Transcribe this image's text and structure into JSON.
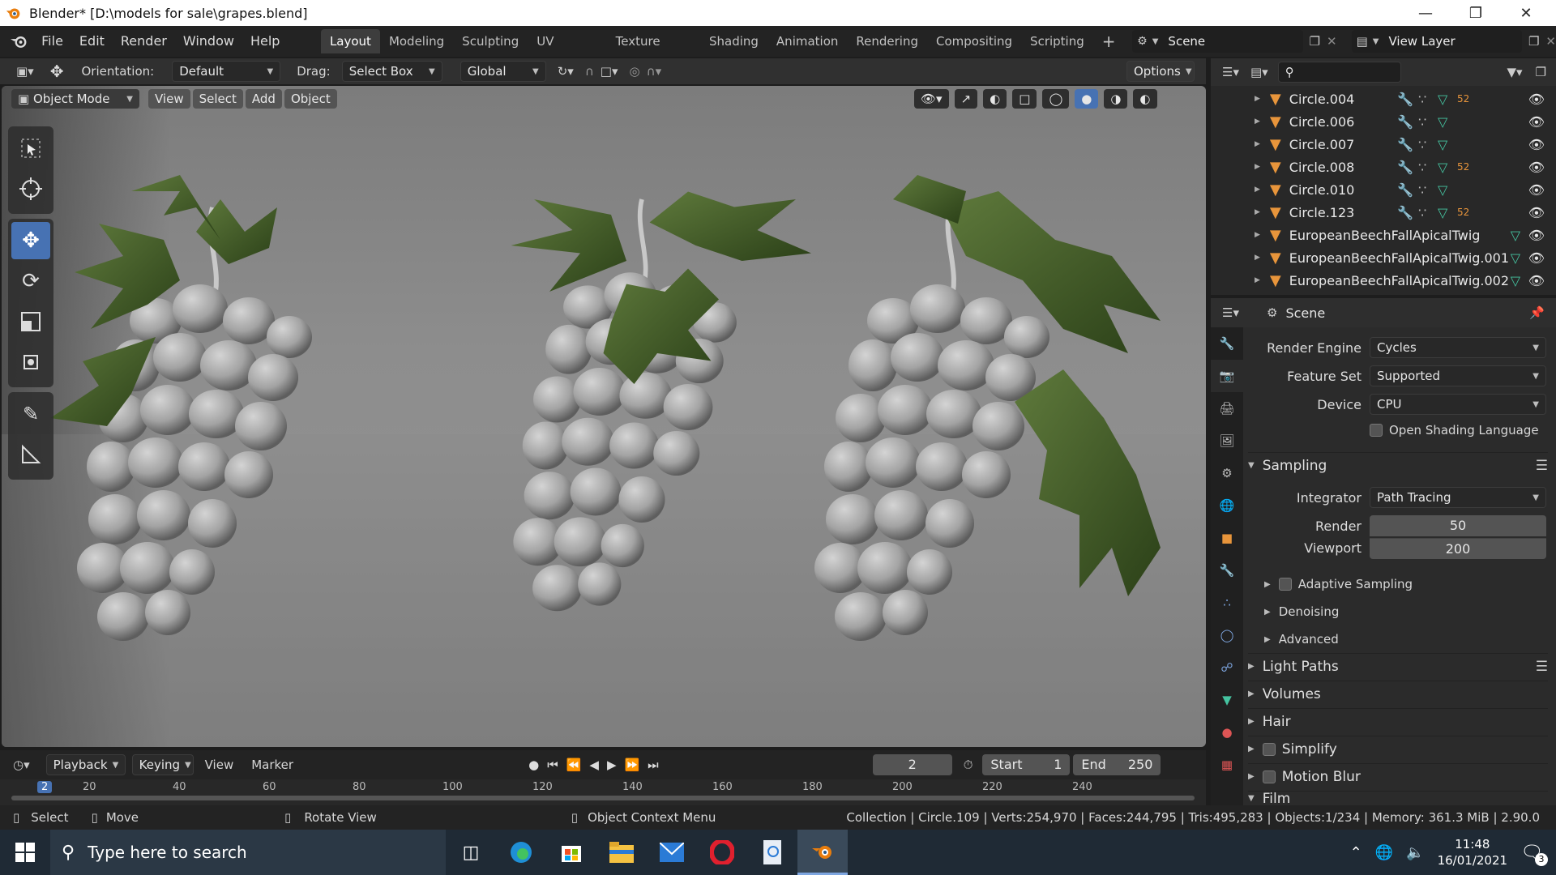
{
  "window": {
    "title": "Blender* [D:\\models for sale\\grapes.blend]"
  },
  "menus": [
    "File",
    "Edit",
    "Render",
    "Window",
    "Help"
  ],
  "workspaces": [
    "Layout",
    "Modeling",
    "Sculpting",
    "UV Editing",
    "Texture Paint",
    "Shading",
    "Animation",
    "Rendering",
    "Compositing",
    "Scripting"
  ],
  "scene": {
    "name": "Scene",
    "view_layer": "View Layer"
  },
  "tool_header": {
    "orientation_label": "Orientation:",
    "orientation_value": "Default",
    "drag_label": "Drag:",
    "drag_value": "Select Box",
    "transform_value": "Global",
    "options_label": "Options"
  },
  "viewport_header": {
    "mode": "Object Mode",
    "buttons": [
      "View",
      "Select",
      "Add",
      "Object"
    ]
  },
  "outliner": {
    "items": [
      {
        "name": "Circle.004",
        "badge": "52"
      },
      {
        "name": "Circle.006",
        "badge": ""
      },
      {
        "name": "Circle.007",
        "badge": ""
      },
      {
        "name": "Circle.008",
        "badge": "52"
      },
      {
        "name": "Circle.010",
        "badge": ""
      },
      {
        "name": "Circle.123",
        "badge": "52"
      },
      {
        "name": "EuropeanBeechFallApicalTwig",
        "badge": ""
      },
      {
        "name": "EuropeanBeechFallApicalTwig.001",
        "badge": ""
      },
      {
        "name": "EuropeanBeechFallApicalTwig.002",
        "badge": ""
      }
    ]
  },
  "properties": {
    "context": "Scene",
    "render_engine_label": "Render Engine",
    "render_engine": "Cycles",
    "feature_set_label": "Feature Set",
    "feature_set": "Supported",
    "device_label": "Device",
    "device": "CPU",
    "osl_label": "Open Shading Language",
    "sampling_label": "Sampling",
    "integrator_label": "Integrator",
    "integrator": "Path Tracing",
    "render_label": "Render",
    "render_samples": "50",
    "viewport_label": "Viewport",
    "viewport_samples": "200",
    "adaptive_label": "Adaptive Sampling",
    "denoising_label": "Denoising",
    "advanced_label": "Advanced",
    "panels": [
      "Light Paths",
      "Volumes",
      "Hair",
      "Simplify",
      "Motion Blur",
      "Film"
    ]
  },
  "timeline": {
    "menus": [
      "Playback",
      "Keying",
      "View",
      "Marker"
    ],
    "current_frame": "2",
    "start_label": "Start",
    "start": "1",
    "end_label": "End",
    "end": "250",
    "ruler": [
      "2",
      "20",
      "40",
      "60",
      "80",
      "100",
      "120",
      "140",
      "160",
      "180",
      "200",
      "220",
      "240"
    ]
  },
  "statusbar": {
    "select": "Select",
    "move": "Move",
    "rotate": "Rotate View",
    "context_menu": "Object Context Menu",
    "stats": "Collection | Circle.109 | Verts:254,970 | Faces:244,795 | Tris:495,283 | Objects:1/234 | Memory: 361.3 MiB | 2.90.0"
  },
  "taskbar": {
    "search_placeholder": "Type here to search",
    "time": "11:48",
    "date": "16/01/2021",
    "notifications": "3"
  },
  "colors": {
    "accent": "#4772b3",
    "object_orange": "#e8953b",
    "mesh_green": "#45c3a0",
    "modifier_blue": "#7ea6e0",
    "taskbar": "#1f2a35"
  }
}
